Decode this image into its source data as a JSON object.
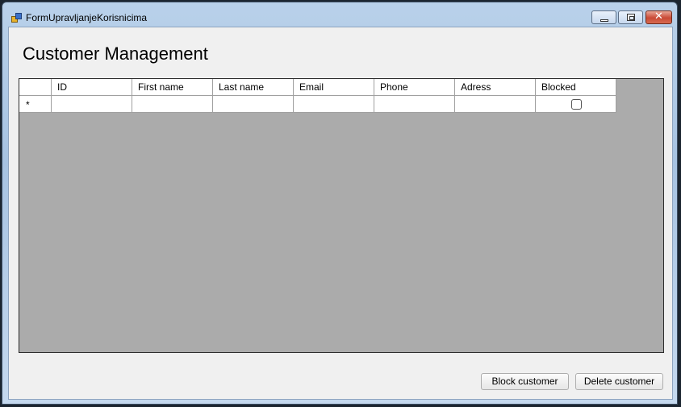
{
  "window": {
    "title": "FormUpravljanjeKorisnicima",
    "close_glyph": "✕"
  },
  "heading": "Customer Management",
  "grid": {
    "columns": [
      "ID",
      "First name",
      "Last name",
      "Email",
      "Phone",
      "Adress",
      "Blocked"
    ],
    "new_row_glyph": "*",
    "new_row": {
      "id": "",
      "first_name": "",
      "last_name": "",
      "email": "",
      "phone": "",
      "adress": "",
      "blocked": false
    }
  },
  "buttons": {
    "block_label": "Block customer",
    "delete_label": "Delete customer"
  },
  "icons": {
    "app": "app-form-icon",
    "minimize": "minimize-icon",
    "maximize": "maximize-icon",
    "close": "close-icon",
    "new_row": "new-row-asterisk-icon",
    "blocked_checkbox": "checkbox-unchecked-icon"
  }
}
